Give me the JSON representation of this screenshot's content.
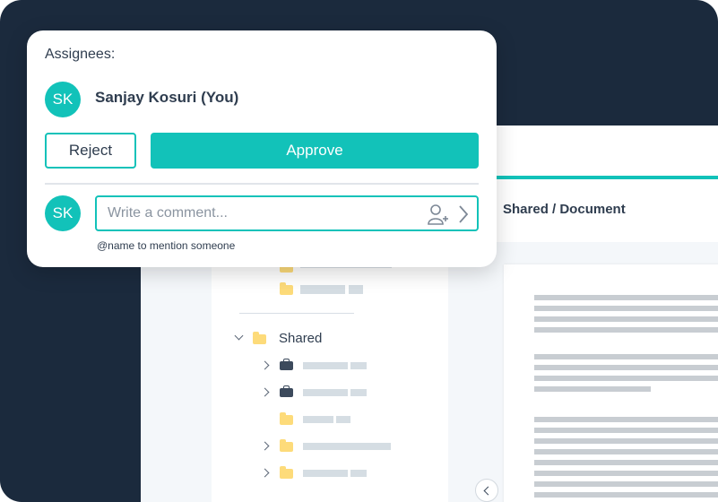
{
  "card": {
    "assignees_label": "Assignees:",
    "assignee": {
      "initials": "SK",
      "name": "Sanjay Kosuri (You)"
    },
    "reject_label": "Reject",
    "approve_label": "Approve",
    "commenter_initials": "SK",
    "comment_placeholder": "Write a comment...",
    "mention_hint": "@name to mention someone"
  },
  "app": {
    "breadcrumb": "Shared / Document",
    "tree": {
      "shared_label": "Shared"
    }
  },
  "icons": {
    "mention": "add-user-icon",
    "send": "chevron-right-icon",
    "collapse": "chevron-left-icon"
  },
  "colors": {
    "accent": "#12c2b9",
    "dark_background": "#1b2a3d",
    "folder": "#fddb7a"
  }
}
